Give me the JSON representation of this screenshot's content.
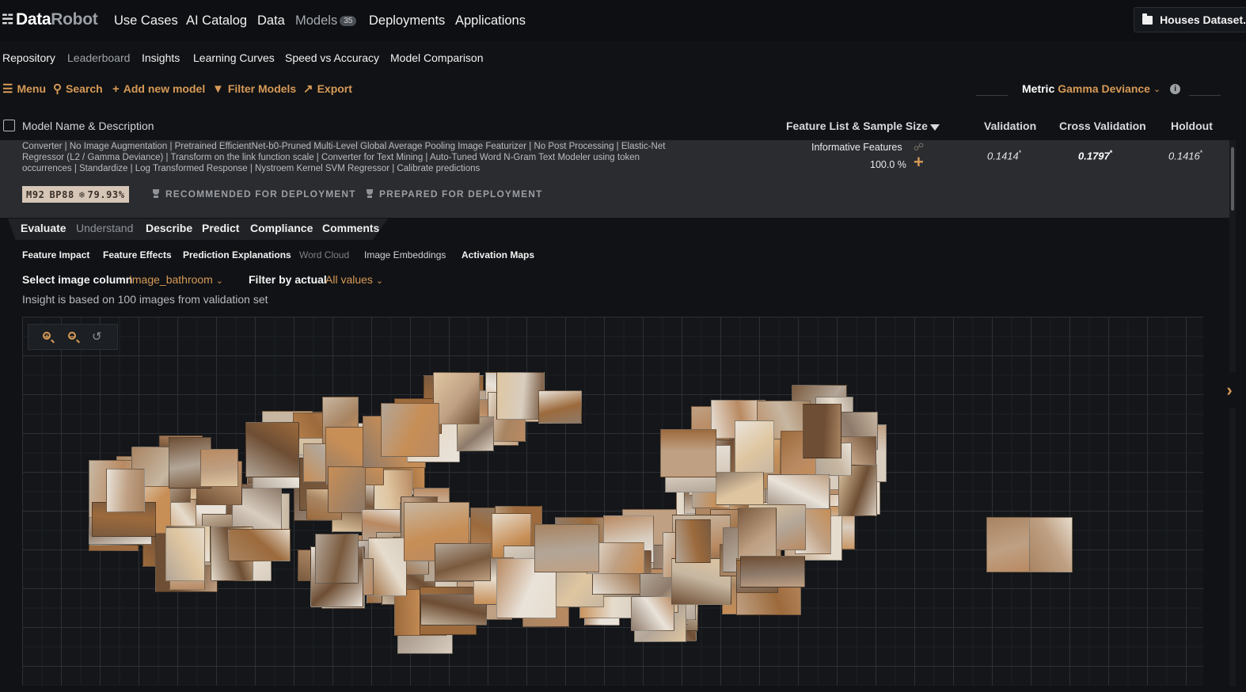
{
  "app": {
    "logo_bold": "Data",
    "logo_light": "Robot",
    "nav": [
      {
        "label": "Use Cases"
      },
      {
        "label": "AI Catalog"
      },
      {
        "label": "Data"
      },
      {
        "label": "Models",
        "badge": "35"
      },
      {
        "label": "Deployments"
      },
      {
        "label": "Applications"
      }
    ],
    "dataset_button": "Houses Dataset.z"
  },
  "subnav": [
    "Repository",
    "Leaderboard",
    "Insights",
    "Learning Curves",
    "Speed vs Accuracy",
    "Model Comparison"
  ],
  "toolbar": {
    "menu": "Menu",
    "search": "Search",
    "add_model": "Add new model",
    "filter": "Filter Models",
    "export": "Export",
    "metric_label": "Metric",
    "metric_value": "Gamma Deviance"
  },
  "table": {
    "headers": {
      "name": "Model Name & Description",
      "feature_list": "Feature List & Sample Size",
      "validation": "Validation",
      "cross_validation": "Cross Validation",
      "holdout": "Holdout"
    },
    "model": {
      "description": "Converter | No Image Augmentation | Pretrained EfficientNet-b0-Pruned Multi-Level Global Average Pooling Image Featurizer | No Post Processing | Elastic-Net Regressor (L2 / Gamma Deviance) | Transform on the link function scale | Converter for Text Mining | Auto-Tuned Word N-Gram Text Modeler using token occurrences | Standardize | Log Transformed Response | Nystroem Kernel SVM Regressor | Calibrate predictions",
      "feature_list": "Informative Features",
      "sample_size": "100.0 %",
      "validation": "0.1414",
      "cross_validation": "0.1797",
      "holdout": "0.1416",
      "score_mark": "*",
      "model_id": "M92",
      "blueprint": "BP88",
      "sample_pct": "79.93%",
      "recommended": "RECOMMENDED FOR DEPLOYMENT",
      "prepared": "PREPARED FOR DEPLOYMENT"
    }
  },
  "tabs": [
    {
      "label": "Evaluate",
      "active": false
    },
    {
      "label": "Understand",
      "active": true
    },
    {
      "label": "Describe",
      "active": false
    },
    {
      "label": "Predict",
      "active": false
    },
    {
      "label": "Compliance",
      "active": false
    },
    {
      "label": "Comments",
      "active": false
    }
  ],
  "subtabs": [
    {
      "label": "Feature Impact"
    },
    {
      "label": "Feature Effects"
    },
    {
      "label": "Prediction Explanations"
    },
    {
      "label": "Word Cloud",
      "disabled": true
    },
    {
      "label": "Image Embeddings",
      "selected": true
    },
    {
      "label": "Activation Maps"
    }
  ],
  "filters": {
    "image_column_label": "Select image column",
    "image_column_value": "Image_bathroom",
    "actual_label": "Filter by actual",
    "actual_value": "All values"
  },
  "insight_note": "Insight is based on 100 images from validation set",
  "colors": {
    "accent": "#d79a57",
    "background": "#101215",
    "row": "#2a2c30"
  },
  "icons": [
    "robot-icon",
    "folder-icon",
    "menu-icon",
    "search-icon",
    "plus-icon",
    "funnel-icon",
    "export-icon",
    "chevron-down-icon",
    "info-icon",
    "link-icon",
    "snowflake-icon",
    "trophy-icon",
    "zoom-in-icon",
    "zoom-out-icon",
    "reset-icon",
    "chevron-right-icon"
  ]
}
